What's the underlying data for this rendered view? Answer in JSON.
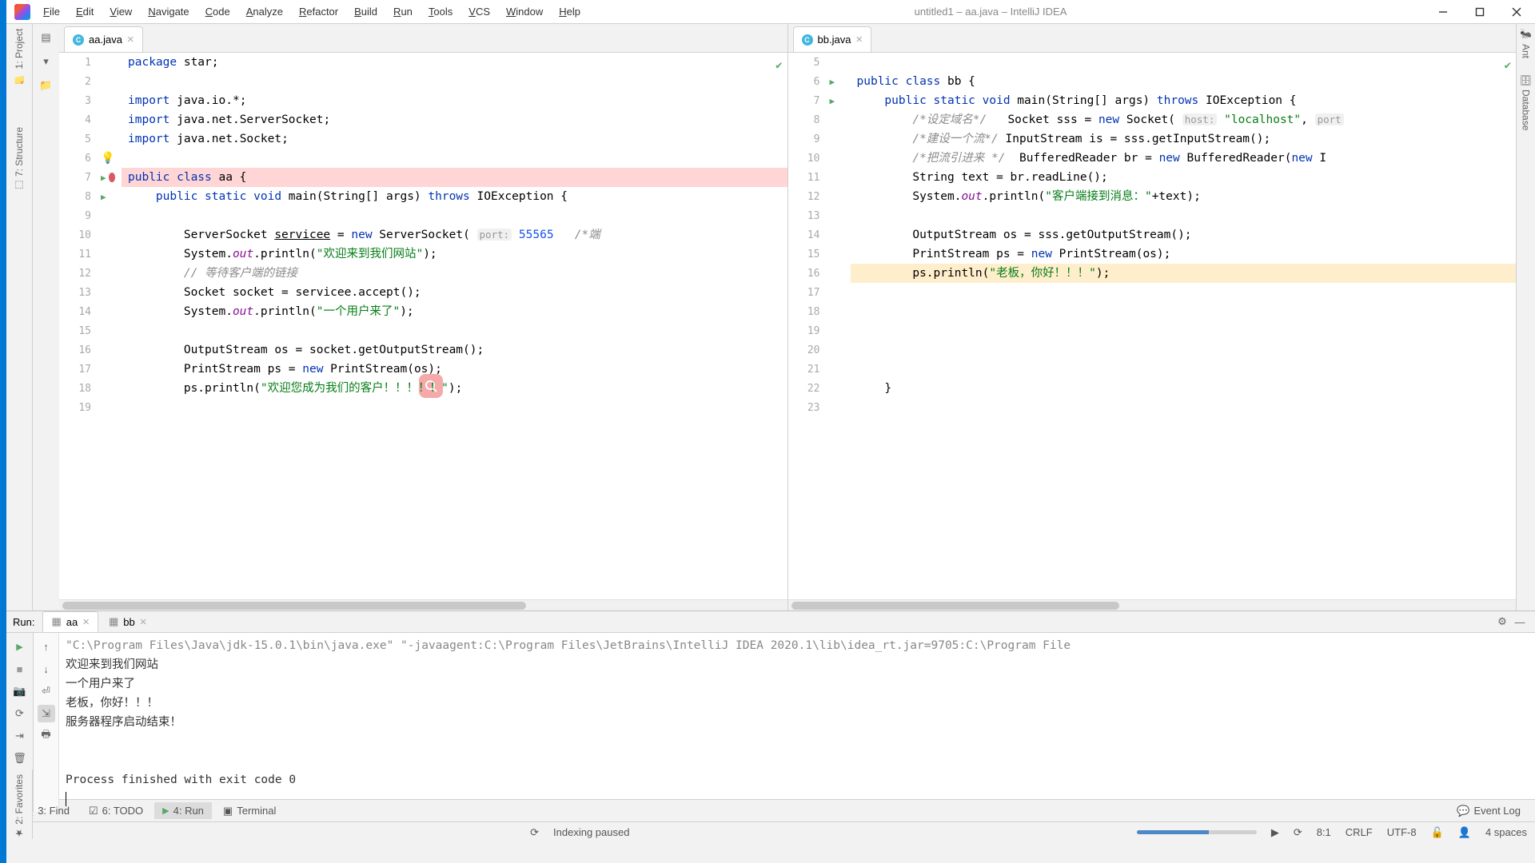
{
  "title": "untitled1 – aa.java – IntelliJ IDEA",
  "menu": [
    "File",
    "Edit",
    "View",
    "Navigate",
    "Code",
    "Analyze",
    "Refactor",
    "Build",
    "Run",
    "Tools",
    "VCS",
    "Window",
    "Help"
  ],
  "leftTools": {
    "project": "1: Project",
    "structure": "7: Structure",
    "favorites": "2: Favorites"
  },
  "rightTools": {
    "ant": "Ant",
    "database": "Database"
  },
  "tabs": {
    "left": "aa.java",
    "right": "bb.java"
  },
  "editorLeft": {
    "startLine": 1,
    "lines": [
      {
        "n": 1,
        "html": "<span class='kw'>package</span> star;"
      },
      {
        "n": 2,
        "html": ""
      },
      {
        "n": 3,
        "html": "<span class='kw'>import</span> java.io.*;"
      },
      {
        "n": 4,
        "html": "<span class='kw'>import</span> java.net.ServerSocket;"
      },
      {
        "n": 5,
        "html": "<span class='kw'>import</span> java.net.Socket;"
      },
      {
        "n": 6,
        "html": "",
        "bulb": true
      },
      {
        "n": 7,
        "html": "<span class='kw'>public class</span> aa {",
        "run": true,
        "bp": true,
        "err": true
      },
      {
        "n": 8,
        "html": "    <span class='kw'>public static void</span> main(String[] args) <span class='kw'>throws</span> IOException {",
        "run": true
      },
      {
        "n": 9,
        "html": ""
      },
      {
        "n": 10,
        "html": "        ServerSocket <u>servicee</u> = <span class='kw'>new</span> ServerSocket( <span class='param-hint'>port:</span> <span class='num-lit'>55565</span>   <span class='cmt'>/*端</span>"
      },
      {
        "n": 11,
        "html": "        System.<span class='fld'>out</span>.println(<span class='str'>\"欢迎来到我们网站\"</span>);"
      },
      {
        "n": 12,
        "html": "        <span class='cmt'>// 等待客户端的链接</span>"
      },
      {
        "n": 13,
        "html": "        Socket socket = servicee.accept();"
      },
      {
        "n": 14,
        "html": "        System.<span class='fld'>out</span>.println(<span class='str'>\"一个用户来了\"</span>);"
      },
      {
        "n": 15,
        "html": ""
      },
      {
        "n": 16,
        "html": "        OutputStream os = socket.getOutputStream();"
      },
      {
        "n": 17,
        "html": "        PrintStream ps = <span class='kw'>new</span> PrintStream(os);"
      },
      {
        "n": 18,
        "html": "        ps.println(<span class='str'>\"欢迎您成为我们的客户！！！！！\"</span>);"
      },
      {
        "n": 19,
        "html": ""
      }
    ]
  },
  "editorRight": {
    "startLine": 5,
    "lines": [
      {
        "n": 5,
        "html": ""
      },
      {
        "n": 6,
        "html": "<span class='kw'>public class</span> bb {",
        "run": true
      },
      {
        "n": 7,
        "html": "    <span class='kw'>public static void</span> main(String[] args) <span class='kw'>throws</span> IOException {",
        "run": true
      },
      {
        "n": 8,
        "html": "        <span class='cmt'>/*设定域名*/</span>   Socket sss = <span class='kw'>new</span> Socket( <span class='param-hint'>host:</span> <span class='str'>\"localhost\"</span>, <span class='param-hint'>port</span>"
      },
      {
        "n": 9,
        "html": "        <span class='cmt'>/*建设一个流*/</span> InputStream is = sss.getInputStream();"
      },
      {
        "n": 10,
        "html": "        <span class='cmt'>/*把流引进来 */</span>  BufferedReader br = <span class='kw'>new</span> BufferedReader(<span class='kw'>new</span> I"
      },
      {
        "n": 11,
        "html": "        String text = br.readLine();"
      },
      {
        "n": 12,
        "html": "        System.<span class='fld'>out</span>.println(<span class='str'>\"客户端接到消息：\"</span>+text);"
      },
      {
        "n": 13,
        "html": ""
      },
      {
        "n": 14,
        "html": "        OutputStream os = sss.getOutputStream();"
      },
      {
        "n": 15,
        "html": "        PrintStream ps = <span class='kw'>new</span> PrintStream(os);"
      },
      {
        "n": 16,
        "html": "        ps.println(<span class='str'>\"老板，你好！！！\"</span>);",
        "hl": true
      },
      {
        "n": 17,
        "html": ""
      },
      {
        "n": 18,
        "html": ""
      },
      {
        "n": 19,
        "html": ""
      },
      {
        "n": 20,
        "html": ""
      },
      {
        "n": 21,
        "html": ""
      },
      {
        "n": 22,
        "html": "    }"
      },
      {
        "n": 23,
        "html": ""
      }
    ]
  },
  "run": {
    "label": "Run:",
    "tabs": [
      {
        "name": "aa",
        "active": true
      },
      {
        "name": "bb",
        "active": false
      }
    ],
    "console_cmd": "\"C:\\Program Files\\Java\\jdk-15.0.1\\bin\\java.exe\" \"-javaagent:C:\\Program Files\\JetBrains\\IntelliJ IDEA 2020.1\\lib\\idea_rt.jar=9705:C:\\Program File",
    "console_lines": [
      "欢迎来到我们网站",
      "一个用户来了",
      "老板，你好！！！",
      "服务器程序启动结束！",
      "",
      "Process finished with exit code 0"
    ]
  },
  "bottomTabs": {
    "find": "3: Find",
    "todo": "6: TODO",
    "run": "4: Run",
    "terminal": "Terminal",
    "eventlog": "Event Log"
  },
  "status": {
    "indexing": "Indexing paused",
    "pos": "8:1",
    "sep": "CRLF",
    "enc": "UTF-8",
    "indent": "4 spaces"
  }
}
